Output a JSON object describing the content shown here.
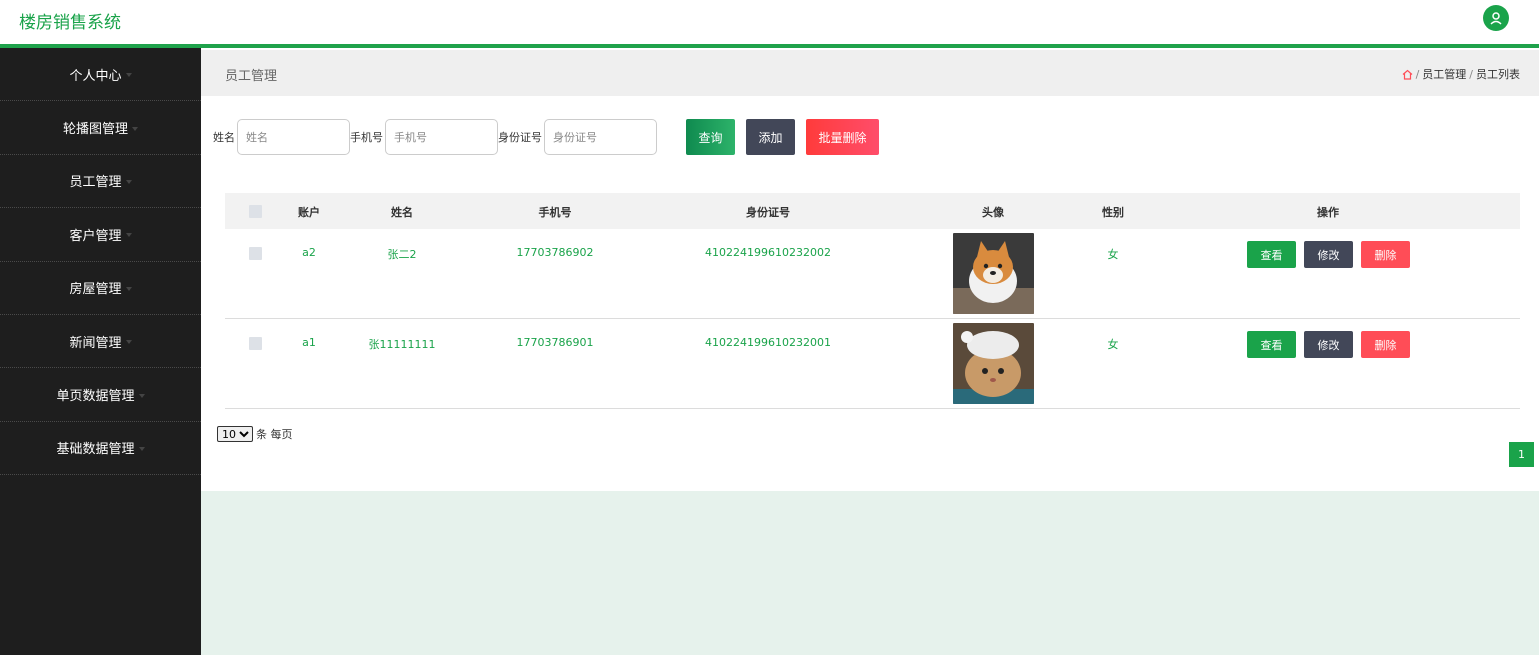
{
  "app": {
    "title": "楼房销售系统",
    "brand_color": "#1aa34a"
  },
  "header": {
    "avatar_icon": "user-icon"
  },
  "sidebar": {
    "items": [
      {
        "label": "个人中心"
      },
      {
        "label": "轮播图管理"
      },
      {
        "label": "员工管理"
      },
      {
        "label": "客户管理"
      },
      {
        "label": "房屋管理"
      },
      {
        "label": "新闻管理"
      },
      {
        "label": "单页数据管理"
      },
      {
        "label": "基础数据管理"
      }
    ]
  },
  "breadcrumb": {
    "title": "员工管理",
    "home_icon": "home-icon",
    "separator": "/",
    "path": [
      "员工管理",
      "员工列表"
    ]
  },
  "search": {
    "name_label": "姓名",
    "name_placeholder": "姓名",
    "phone_label": "手机号",
    "phone_placeholder": "手机号",
    "id_label": "身份证号",
    "id_placeholder": "身份证号",
    "query_label": "查询",
    "add_label": "添加",
    "batch_delete_label": "批量删除"
  },
  "table": {
    "headers": {
      "account": "账户",
      "name": "姓名",
      "phone": "手机号",
      "id_number": "身份证号",
      "avatar": "头像",
      "gender": "性别",
      "actions": "操作"
    },
    "rows": [
      {
        "account": "a2",
        "name": "张二2",
        "phone": "17703786902",
        "id_number": "410224199610232002",
        "avatar": "shiba-dog-photo",
        "gender": "女",
        "view": "查看",
        "edit": "修改",
        "delete": "删除"
      },
      {
        "account": "a1",
        "name": "张11111111",
        "phone": "17703786901",
        "id_number": "410224199610232001",
        "avatar": "cat-photo",
        "gender": "女",
        "view": "查看",
        "edit": "修改",
        "delete": "删除"
      }
    ]
  },
  "pagination": {
    "page_size": "10",
    "page_size_suffix": "条 每页",
    "current_page": "1"
  }
}
